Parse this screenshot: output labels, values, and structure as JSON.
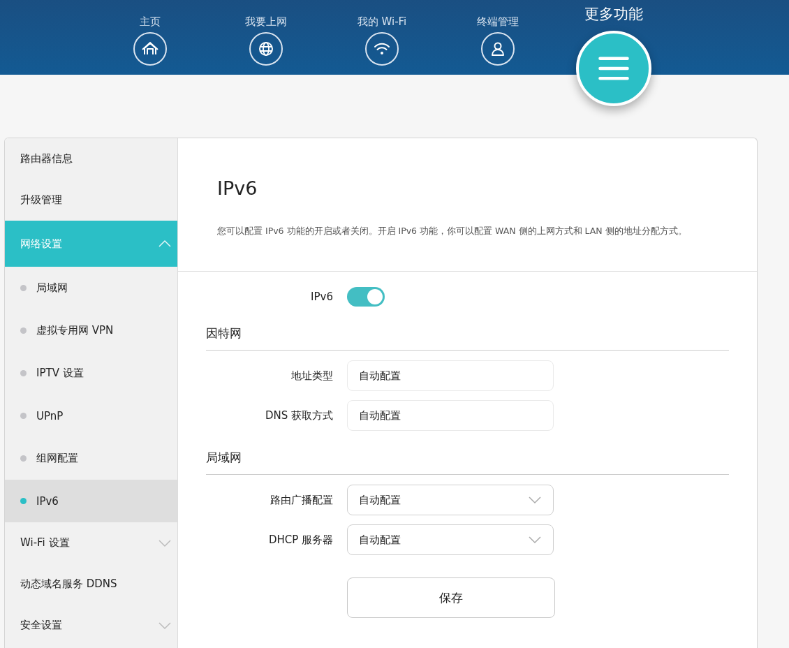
{
  "nav": [
    {
      "label": "主页",
      "kind": "home",
      "selected": false
    },
    {
      "label": "我要上网",
      "kind": "globe",
      "selected": false
    },
    {
      "label": "我的 Wi-Fi",
      "kind": "wifi",
      "selected": false
    },
    {
      "label": "终端管理",
      "kind": "user",
      "selected": false
    },
    {
      "label": "更多功能",
      "kind": "menu",
      "selected": true
    }
  ],
  "sidebar": {
    "items": [
      {
        "label": "路由器信息",
        "selected": false
      },
      {
        "label": "升级管理",
        "selected": false
      },
      {
        "label": "网络设置",
        "kind": "group",
        "selected": true,
        "expanded": true,
        "children": [
          {
            "label": "局域网",
            "selected": false
          },
          {
            "label": "虚拟专用网 VPN",
            "selected": false
          },
          {
            "label": "IPTV 设置",
            "selected": false
          },
          {
            "label": "UPnP",
            "selected": false
          },
          {
            "label": "组网配置",
            "selected": false
          },
          {
            "label": "IPv6",
            "selected": true
          }
        ]
      },
      {
        "label": "Wi-Fi 设置",
        "kind": "group",
        "selected": false,
        "expanded": false
      },
      {
        "label": "动态域名服务 DDNS",
        "selected": false
      },
      {
        "label": "安全设置",
        "kind": "group",
        "selected": false,
        "expanded": false
      }
    ]
  },
  "page": {
    "title": "IPv6",
    "description": "您可以配置 IPv6 功能的开启或者关闭。开启 IPv6 功能，你可以配置 WAN 侧的上网方式和 LAN 侧的地址分配方式。"
  },
  "toggle": {
    "label": "IPv6",
    "on": true
  },
  "sections": [
    {
      "title": "因特网",
      "fields": [
        {
          "label": "地址类型",
          "kind": "text",
          "value": "自动配置"
        },
        {
          "label": "DNS 获取方式",
          "kind": "text",
          "value": "自动配置"
        }
      ]
    },
    {
      "title": "局域网",
      "fields": [
        {
          "label": "路由广播配置",
          "kind": "select",
          "value": "自动配置"
        },
        {
          "label": "DHCP 服务器",
          "kind": "select",
          "value": "自动配置"
        }
      ]
    }
  ],
  "save_button": "保存"
}
